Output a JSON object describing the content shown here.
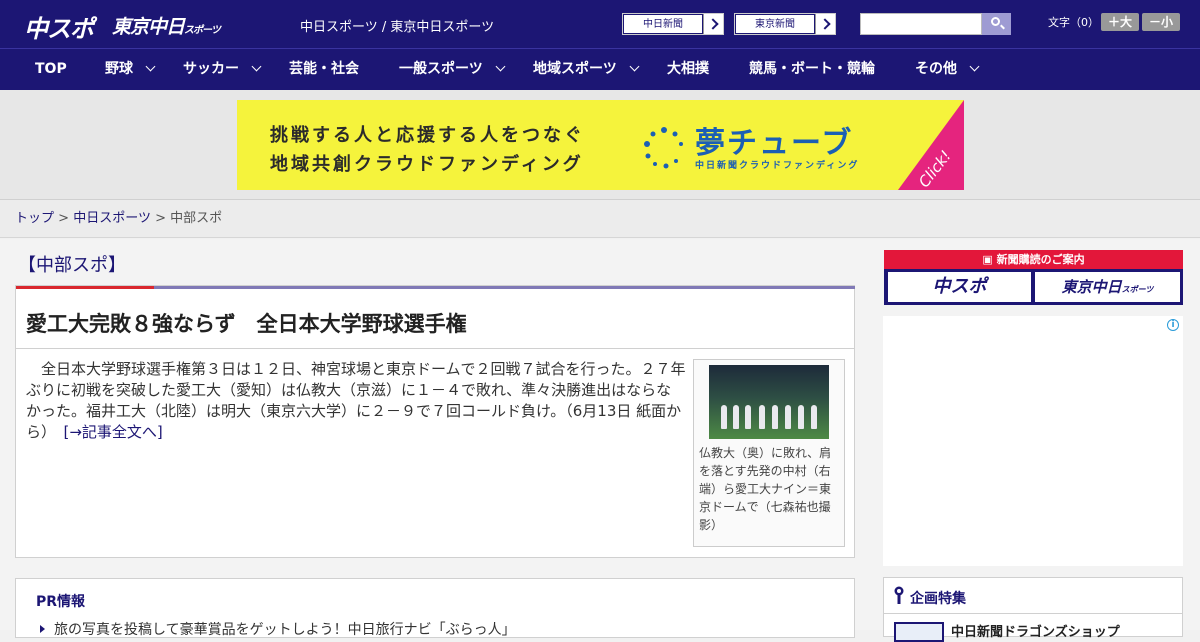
{
  "header": {
    "logo_chunichi_sports": "中スポ",
    "logo_tokyo_chunichi": "東京中日",
    "logo_tokyo_chunichi_suffix": "スポーツ",
    "site_links": "中日スポーツ / 東京中日スポーツ",
    "paper_buttons": [
      "中日新聞",
      "東京新聞"
    ],
    "search_placeholder": "",
    "text_size_label": "文字（0）",
    "size_up": "＋大",
    "size_down": "－小"
  },
  "nav": {
    "items": [
      {
        "label": "TOP",
        "dropdown": false
      },
      {
        "label": "野球",
        "dropdown": true
      },
      {
        "label": "サッカー",
        "dropdown": true
      },
      {
        "label": "芸能・社会",
        "dropdown": false
      },
      {
        "label": "一般スポーツ",
        "dropdown": true
      },
      {
        "label": "地域スポーツ",
        "dropdown": true
      },
      {
        "label": "大相撲",
        "dropdown": false
      },
      {
        "label": "競馬・ボート・競輪",
        "dropdown": false
      },
      {
        "label": "その他",
        "dropdown": true
      }
    ]
  },
  "banner": {
    "line1": "挑戦する人と応援する人をつなぐ",
    "line2": "地域共創クラウドファンディング",
    "brand": "夢チューブ",
    "brand_sub": "中日新聞クラウドファンディング",
    "click": "Click!"
  },
  "breadcrumb": {
    "items": [
      "トップ",
      "中日スポーツ"
    ],
    "current": "中部スポ",
    "separator": ">"
  },
  "main": {
    "section_title": "【中部スポ】",
    "article": {
      "title": "愛工大完敗８強ならず　全日本大学野球選手権",
      "body": "　全日本大学野球選手権第３日は１２日、神宮球場と東京ドームで２回戦７試合を行った。２７年ぶりに初戦を突破した愛工大（愛知）は仏教大（京滋）に１－４で敗れ、準々決勝進出はならなかった。福井工大（北陸）は明大（東京六大学）に２－９で７回コールド負け。（6月13日 紙面から）　",
      "more_link": "[→記事全文へ]",
      "photo_caption": "仏教大（奥）に敗れ、肩を落とす先発の中村（右端）ら愛工大ナイン＝東京ドームで（七森祐也撮影）"
    },
    "pr": {
      "title": "PR情報",
      "item": "旅の写真を投稿して豪華賞品をゲットしよう！中日旅行ナビ「ぶらっ人」"
    }
  },
  "sidebar": {
    "subscribe_header": "新聞購読のご案内",
    "subscribe_chunichi": "中スポ",
    "subscribe_tokyo": "東京中日",
    "subscribe_tokyo_suffix": "スポーツ",
    "ad_info": "i",
    "feature_title": "企画特集",
    "feature_item": "中日新聞ドラゴンズショップ"
  },
  "colors": {
    "header_navy": "#1c1674",
    "accent_red": "#d9272e",
    "banner_yellow": "#f5f33c",
    "banner_blue": "#1b5fb4",
    "click_pink": "#e5247e"
  }
}
